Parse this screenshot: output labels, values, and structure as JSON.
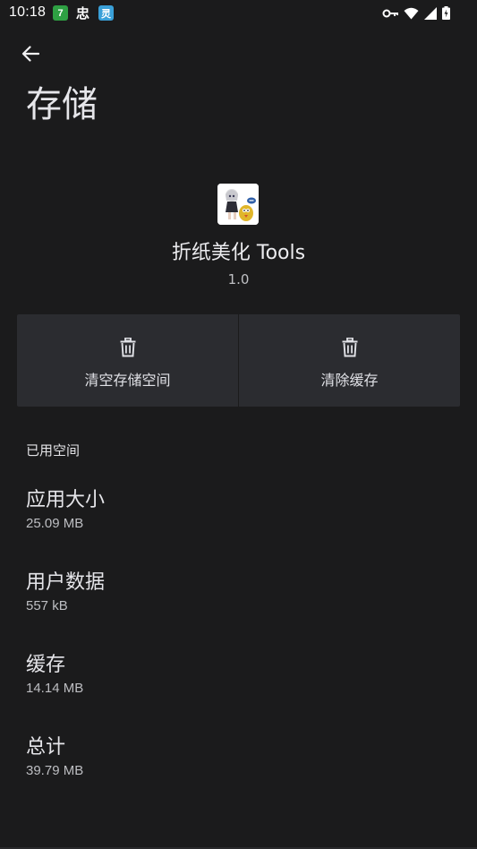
{
  "status_bar": {
    "time": "10:18",
    "app_icon_1": "7",
    "app_icon_2": "忠",
    "app_icon_3": "灵"
  },
  "header": {
    "title": "存储"
  },
  "app": {
    "name": "折纸美化 Tools",
    "version": "1.0"
  },
  "actions": {
    "clear_storage": "清空存储空间",
    "clear_cache": "清除缓存"
  },
  "storage": {
    "section_title": "已用空间",
    "items": [
      {
        "label": "应用大小",
        "value": "25.09 MB"
      },
      {
        "label": "用户数据",
        "value": "557 kB"
      },
      {
        "label": "缓存",
        "value": "14.14 MB"
      },
      {
        "label": "总计",
        "value": "39.79 MB"
      }
    ]
  },
  "colors": {
    "background": "#1b1b1c",
    "button_bg": "#2b2c30",
    "text_primary": "#e6e6ea",
    "text_secondary": "#bdbec2"
  }
}
